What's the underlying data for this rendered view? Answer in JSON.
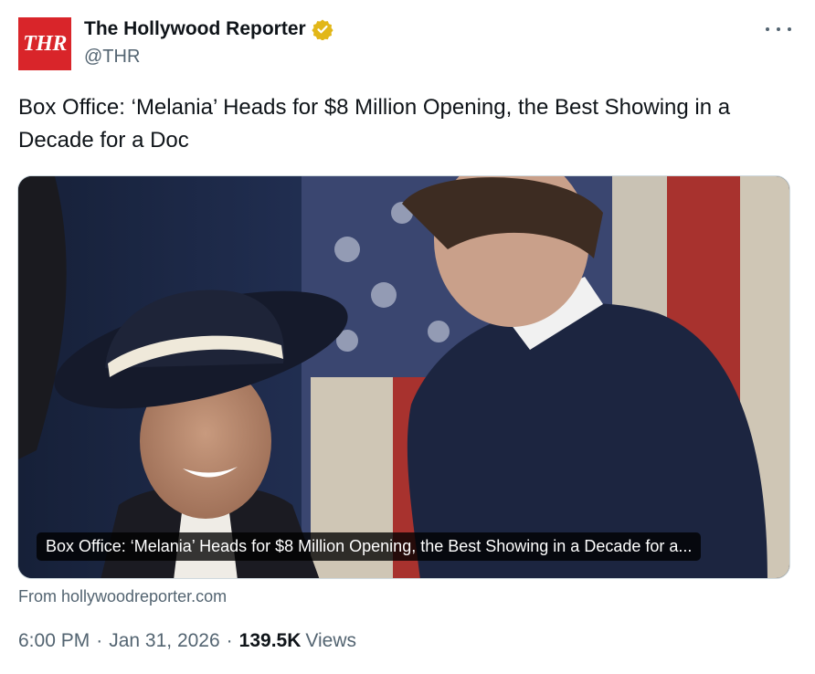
{
  "author": {
    "logo_text": "THR",
    "name": "The Hollywood Reporter",
    "handle": "@THR",
    "verified_color": "#e2b719",
    "brand_color": "#d9252a"
  },
  "tweet": {
    "text": "Box Office: ‘Melania’ Heads for $8 Million Opening, the Best Showing in a Decade for a Doc"
  },
  "card": {
    "title": "Box Office: ‘Melania’ Heads for $8 Million Opening, the Best Showing in a Decade for a...",
    "source": "From hollywoodreporter.com"
  },
  "meta": {
    "time": "6:00 PM",
    "separator": "·",
    "date": "Jan 31, 2026",
    "views_count": "139.5K",
    "views_label": "Views"
  },
  "icons": {
    "more": "more-horizontal-icon",
    "verified": "verified-badge-icon"
  }
}
